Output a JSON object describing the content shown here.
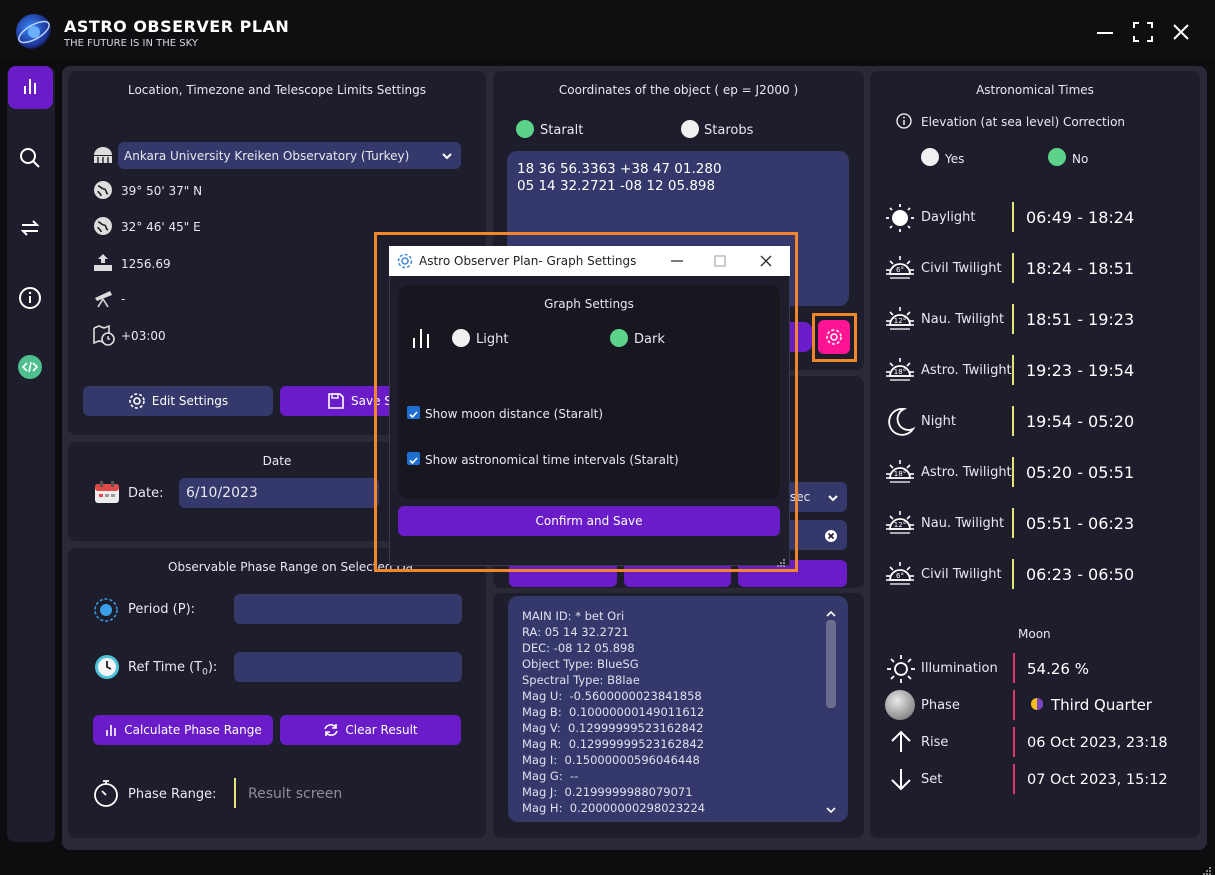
{
  "app": {
    "title": "ASTRO OBSERVER PLAN",
    "subtitle": "THE FUTURE IS IN THE SKY"
  },
  "location": {
    "title": "Location, Timezone and Telescope Limits Settings",
    "observatory": "Ankara University Kreiken Observatory (Turkey)",
    "latitude": "39° 50' 37\" N",
    "longitude": "32° 46' 45\" E",
    "altitude": "1256.69",
    "limit": "-",
    "timezone": "+03:00",
    "edit_label": "Edit Settings",
    "save_label": "Save Se"
  },
  "date": {
    "title": "Date",
    "label": "Date:",
    "value": "6/10/2023"
  },
  "phase": {
    "title": "Observable Phase Range on Selected Da",
    "period_label": "Period (P):",
    "ref_label": "Ref Time (T",
    "ref_sub": "0",
    "ref_tail": "):",
    "calc_label": "Calculate Phase Range",
    "clear_label": "Clear Result",
    "range_label": "Phase Range:",
    "result_placeholder": "Result screen"
  },
  "coords": {
    "title": "Coordinates of the object ( ep = J2000 )",
    "opt_staralt": "Staralt",
    "opt_starobs": "Starobs",
    "text": "18 36 56.3363 +38 47 01.280\n05 14 32.2721 -08 12 05.898",
    "sec_label": "sec"
  },
  "info": {
    "lines": [
      "MAIN ID: * bet Ori",
      "RA: 05 14 32.2721",
      "DEC: -08 12 05.898",
      "Object Type: BlueSG",
      "Spectral Type: B8Iae",
      "Mag U:  -0.5600000023841858",
      "Mag B:  0.10000000149011612",
      "Mag V:  0.12999999523162842",
      "Mag R:  0.12999999523162842",
      "Mag I:  0.15000000596046448",
      "Mag G:  --",
      "Mag J:  0.2199999988079071",
      "Mag H:  0.20000000298023224"
    ]
  },
  "astro": {
    "title": "Astronomical Times",
    "elevation_label": "Elevation (at sea level) Correction",
    "yes": "Yes",
    "no": "No",
    "rows": [
      {
        "label": "Daylight",
        "value": "06:49 - 18:24",
        "icon": "sun-icon"
      },
      {
        "label": "Civil Twilight",
        "value": "18:24 - 18:51",
        "icon": "sunset-6-icon",
        "deg": "6°"
      },
      {
        "label": "Nau. Twilight",
        "value": "18:51 - 19:23",
        "icon": "sunset-12-icon",
        "deg": "12°"
      },
      {
        "label": "Astro. Twilight",
        "value": "19:23 - 19:54",
        "icon": "sunset-18-icon",
        "deg": "18°"
      },
      {
        "label": "Night",
        "value": "19:54 - 05:20",
        "icon": "moon-icon"
      },
      {
        "label": "Astro. Twilight",
        "value": "05:20 - 05:51",
        "icon": "sunset-18-icon",
        "deg": "18°"
      },
      {
        "label": "Nau. Twilight",
        "value": "05:51 - 06:23",
        "icon": "sunset-12-icon",
        "deg": "12°"
      },
      {
        "label": "Civil Twilight",
        "value": "06:23 - 06:50",
        "icon": "sunset-6-icon",
        "deg": "6°"
      }
    ],
    "moon_title": "Moon",
    "illumination_label": "Illumination",
    "illumination": "54.26 %",
    "phase_label": "Phase",
    "phase": "Third Quarter",
    "rise_label": "Rise",
    "rise": "06 Oct 2023, 23:18",
    "set_label": "Set",
    "set": "07 Oct 2023, 15:12"
  },
  "dialog": {
    "title": "Astro Observer Plan- Graph Settings",
    "heading": "Graph Settings",
    "light": "Light",
    "dark": "Dark",
    "moon_distance": "Show moon distance (Staralt)",
    "time_intervals": "Show astronomical time intervals (Staralt)",
    "confirm": "Confirm and Save"
  },
  "colors": {
    "accent": "#6a1cc8",
    "pink": "#ff1493",
    "highlight": "#f2862a",
    "green": "#5dd28a"
  }
}
